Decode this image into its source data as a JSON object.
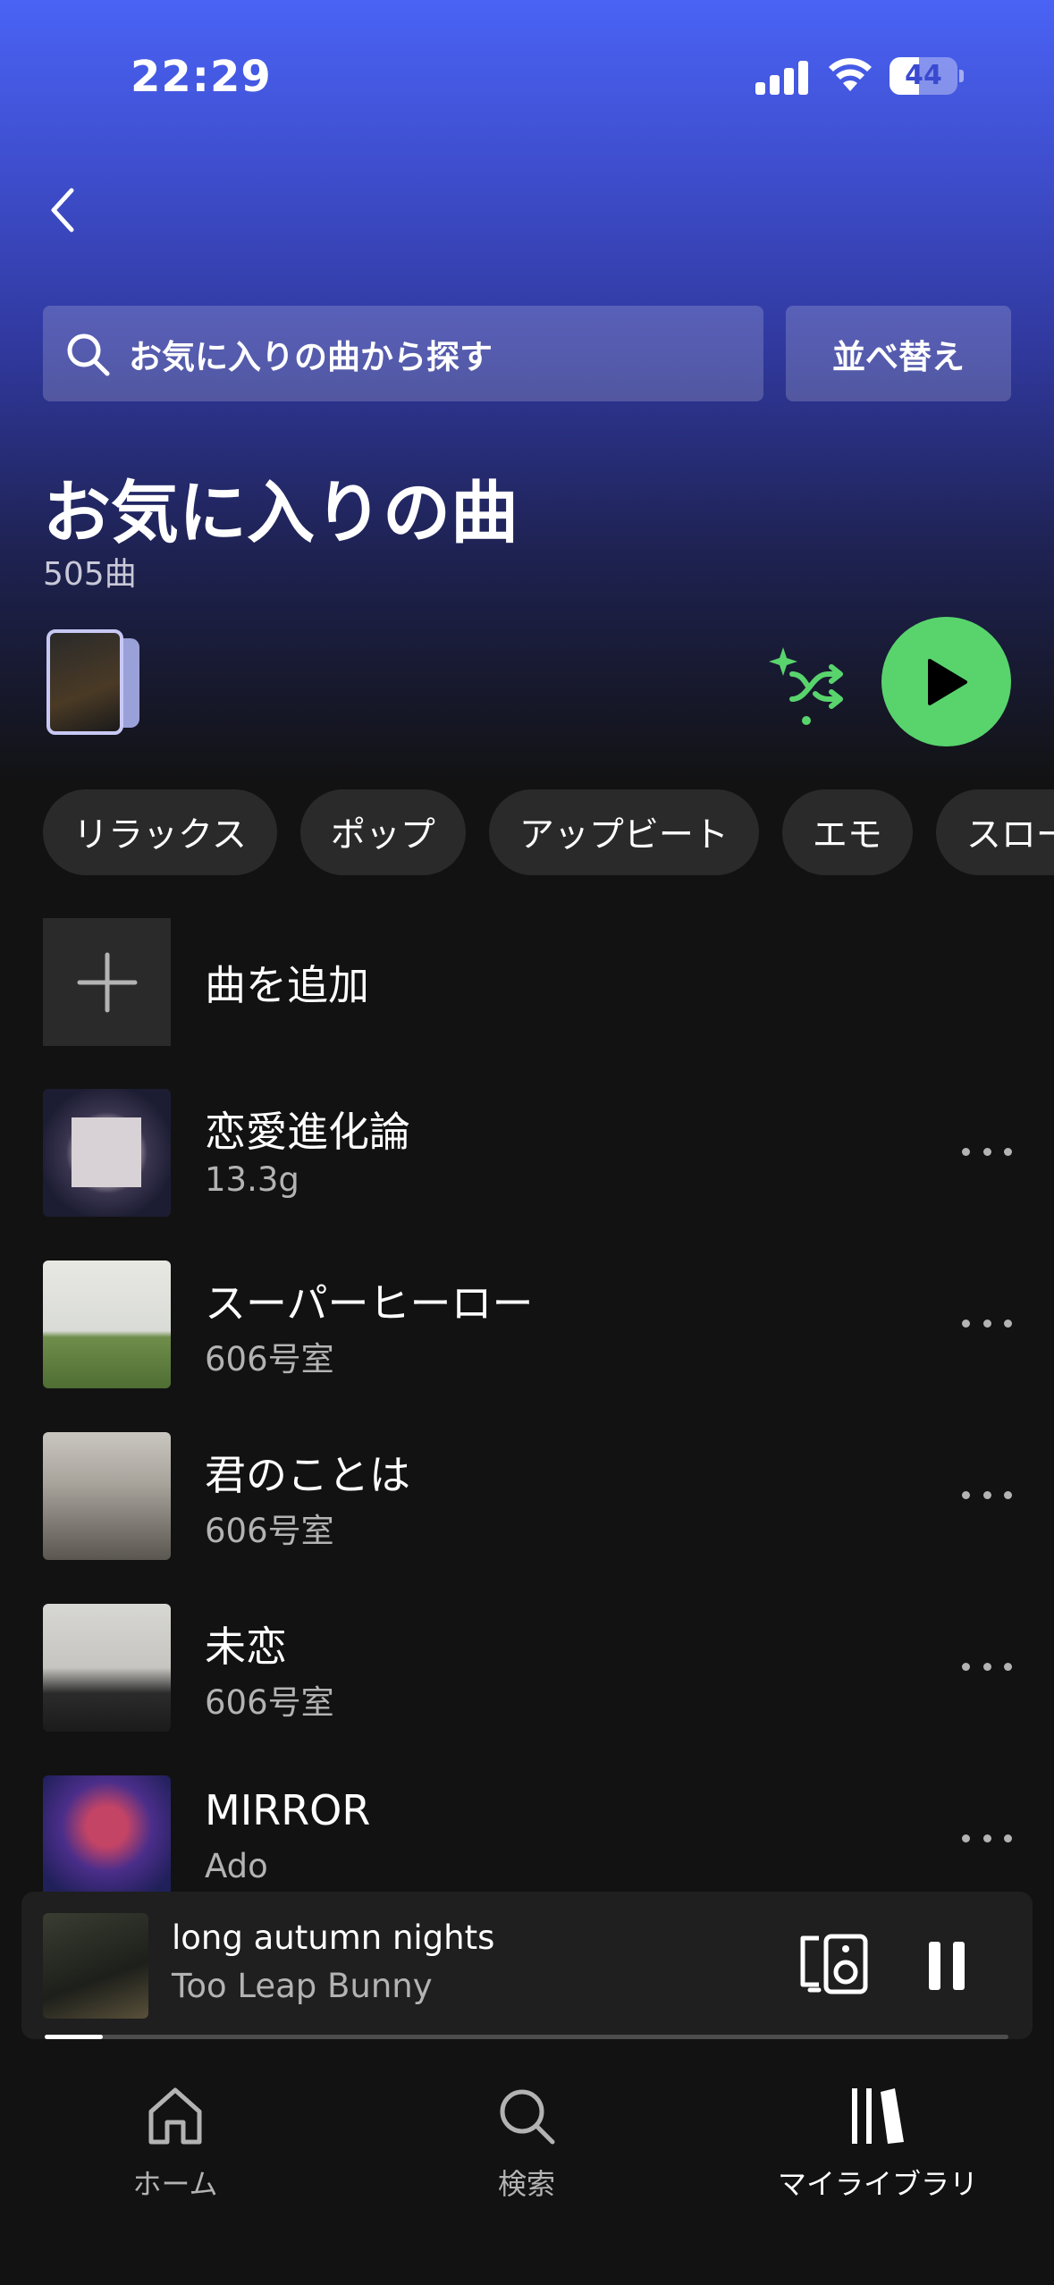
{
  "status_bar": {
    "time": "22:29",
    "battery_level": "44",
    "battery_fraction": 0.44
  },
  "header": {
    "search_placeholder": "お気に入りの曲から探す",
    "sort_label": "並べ替え"
  },
  "playlist": {
    "title": "お気に入りの曲",
    "song_count": "505曲"
  },
  "chips": [
    "リラックス",
    "ポップ",
    "アップビート",
    "エモ",
    "スロー"
  ],
  "add_song_label": "曲を追加",
  "tracks": [
    {
      "title": "恋愛進化論",
      "artist": "13.3g"
    },
    {
      "title": "スーパーヒーロー",
      "artist": "606号室"
    },
    {
      "title": "君のことは",
      "artist": "606号室"
    },
    {
      "title": "未恋",
      "artist": "606号室"
    },
    {
      "title": "MIRROR",
      "artist": "Ado"
    }
  ],
  "now_playing": {
    "title": "long autumn nights",
    "artist": "Too Leap Bunny",
    "progress_fraction": 0.06
  },
  "tab_bar": {
    "home": "ホーム",
    "search": "検索",
    "library": "マイライブラリ"
  },
  "colors": {
    "accent_green": "#59d46d",
    "header_blue": "#4a63f5",
    "background": "#121212"
  }
}
